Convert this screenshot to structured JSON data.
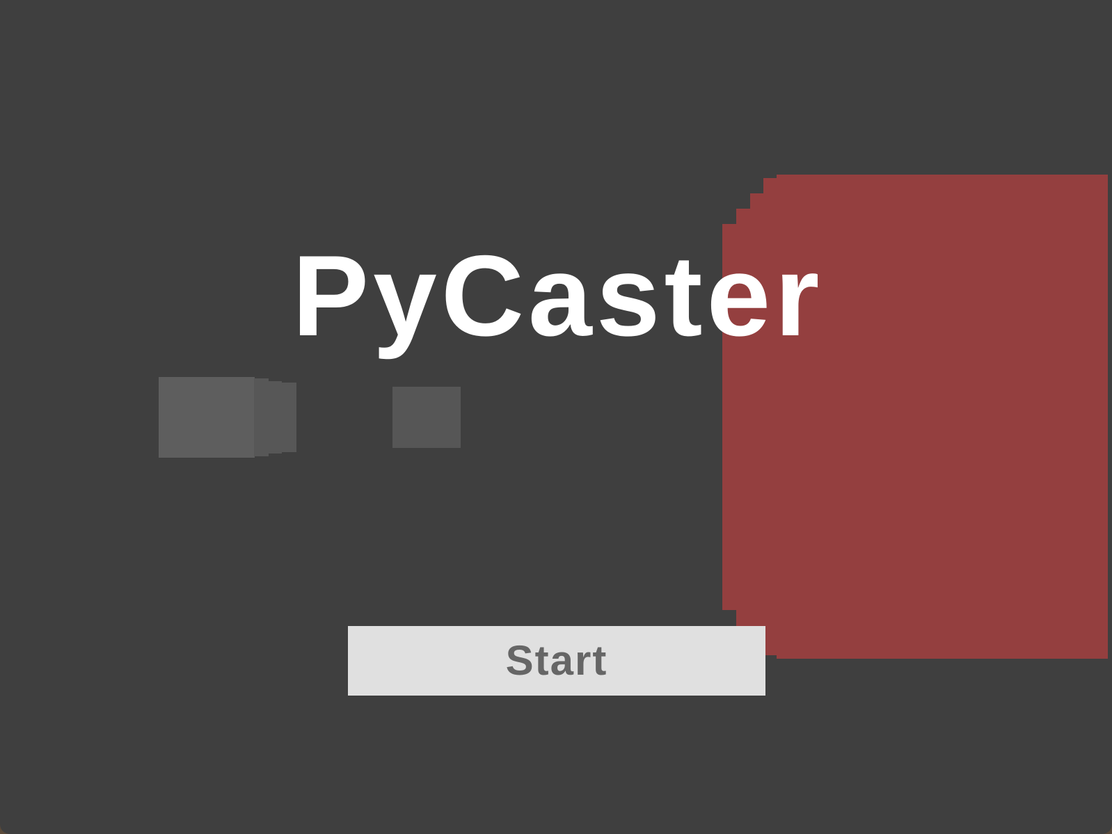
{
  "game": {
    "title": "PyCaster",
    "start_label": "Start"
  },
  "colors": {
    "background": "#3f3f3f",
    "wall_red": "#943f3f",
    "wall_grey": "#5e5e5e",
    "button_bg": "#e0e0e0",
    "button_text": "#666666",
    "title_text": "#ffffff"
  }
}
